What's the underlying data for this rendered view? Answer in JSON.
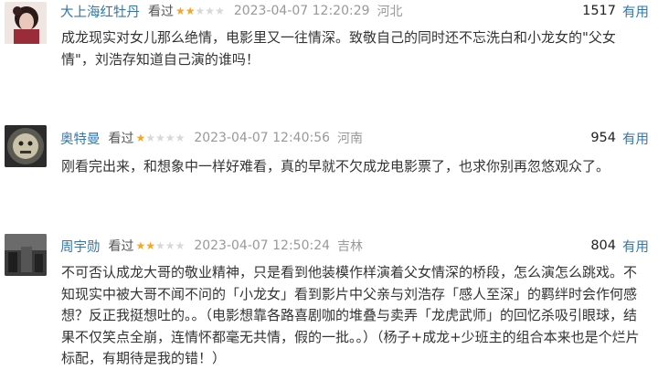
{
  "colors": {
    "link": "#3377aa",
    "star_on": "#f5a623",
    "star_off": "#d8d8d8",
    "meta": "#999999"
  },
  "comments": [
    {
      "username": "大上海红牡丹",
      "watched": "看过",
      "rating": 2,
      "rating_max": 5,
      "date": "2023-04-07 12:20:29",
      "location": "河北",
      "votes": "1517",
      "useful": "有用",
      "text": "成龙现实对女儿那么绝情，电影里又一往情深。致敬自己的同时还不忘洗白和小龙女的\"父女情\"，刘浩存知道自己演的谁吗！"
    },
    {
      "username": "奥特曼",
      "watched": "看过",
      "rating": 1,
      "rating_max": 5,
      "date": "2023-04-07 12:40:56",
      "location": "河南",
      "votes": "954",
      "useful": "有用",
      "text": "刚看完出来，和想象中一样好难看，真的早就不欠成龙电影票了，也求你别再忽悠观众了。"
    },
    {
      "username": "周宇勋",
      "watched": "看过",
      "rating": 2,
      "rating_max": 5,
      "date": "2023-04-07 12:50:24",
      "location": "吉林",
      "votes": "804",
      "useful": "有用",
      "text": "不可否认成龙大哥的敬业精神，只是看到他装模作样演着父女情深的桥段，怎么演怎么跳戏。不知现实中被大哥不闻不问的「小龙女」看到影片中父亲与刘浩存「感人至深」的羁绊时会作何感想？反正我挺想吐的。。（电影想靠各路喜剧咖的堆叠与卖弄「龙虎武师」的回忆杀吸引眼球，结果不仅笑点全崩，连情怀都毫无共情，假的一批。。）（杨子+成龙+少班主的组合本来也是个烂片标配，有期待是我的错！）"
    }
  ]
}
